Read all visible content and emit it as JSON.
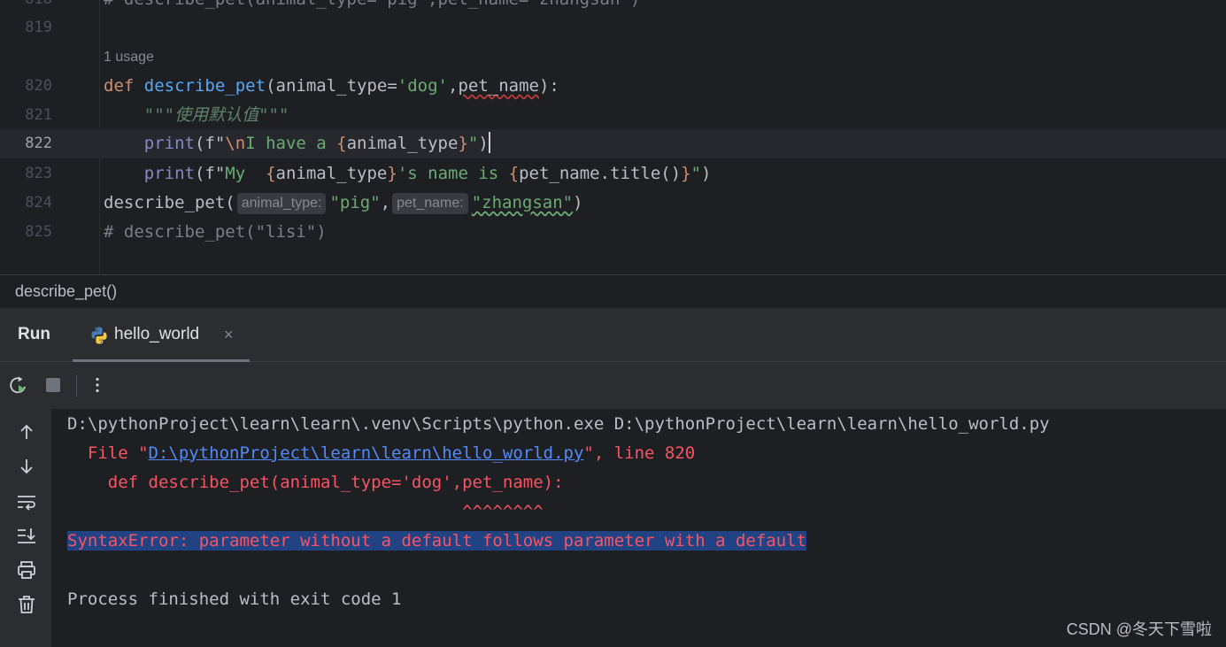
{
  "editor": {
    "partial_line": "# describe_pet(animal_type='pig',pet_name='zhangsan')",
    "usage_hint": "1 usage",
    "lines": [
      {
        "num": "819"
      },
      {
        "num": "820",
        "def_kw": "def",
        "fn_name": "describe_pet",
        "p1": "(animal_type=",
        "p1_default": "'dog'",
        "p2_sep": ",",
        "p2": "pet_name",
        "tail": "):"
      },
      {
        "num": "821",
        "docstring": "\"\"\"使用默认值\"\"\""
      },
      {
        "num": "822",
        "builtin": "print",
        "open": "(f\"",
        "esc": "\\n",
        "text": "I have a ",
        "lb": "{",
        "var": "animal_type",
        "rb": "}",
        "close_str": "\"",
        "close": ")"
      },
      {
        "num": "823",
        "builtin": "print",
        "open": "(f\"",
        "text1": "My  ",
        "lb": "{",
        "var": "animal_type",
        "rb": "}",
        "text2": "'s name is ",
        "lb2": "{",
        "expr": "pet_name.title()",
        "rb2": "}",
        "close_str": "\"",
        "close": ")"
      },
      {
        "num": "824",
        "call": "describe_pet(",
        "hint1": "animal_type:",
        "arg1": "\"pig\"",
        "comma": ",",
        "hint2": "pet_name:",
        "arg2": "\"zhangsan\"",
        "close": ")"
      },
      {
        "num": "825",
        "comment": "# describe_pet(\"lisi\")"
      }
    ],
    "partial_num": "818"
  },
  "breadcrumb": "describe_pet()",
  "run_window": {
    "title": "Run",
    "tab_label": "hello_world",
    "tab_close": "×"
  },
  "console": {
    "cmd": "D:\\pythonProject\\learn\\learn\\.venv\\Scripts\\python.exe D:\\pythonProject\\learn\\learn\\hello_world.py",
    "file_prefix": "  File \"",
    "file_link": "D:\\pythonProject\\learn\\learn\\hello_world.py",
    "file_suffix": "\", line 820",
    "src_line": "    def describe_pet(animal_type='dog',pet_name):",
    "carets": "                                       ^^^^^^^^",
    "error": "SyntaxError: parameter without a default follows parameter with a default",
    "exit": "Process finished with exit code 1"
  },
  "icons": {
    "rerun": "rerun-icon",
    "stop": "stop-icon",
    "more": "more-vertical-icon",
    "up": "arrow-up-icon",
    "down": "arrow-down-icon",
    "wrap": "soft-wrap-icon",
    "scroll_end": "scroll-to-end-icon",
    "print": "print-icon",
    "trash": "trash-icon"
  },
  "watermark": "CSDN @冬天下雪啦"
}
